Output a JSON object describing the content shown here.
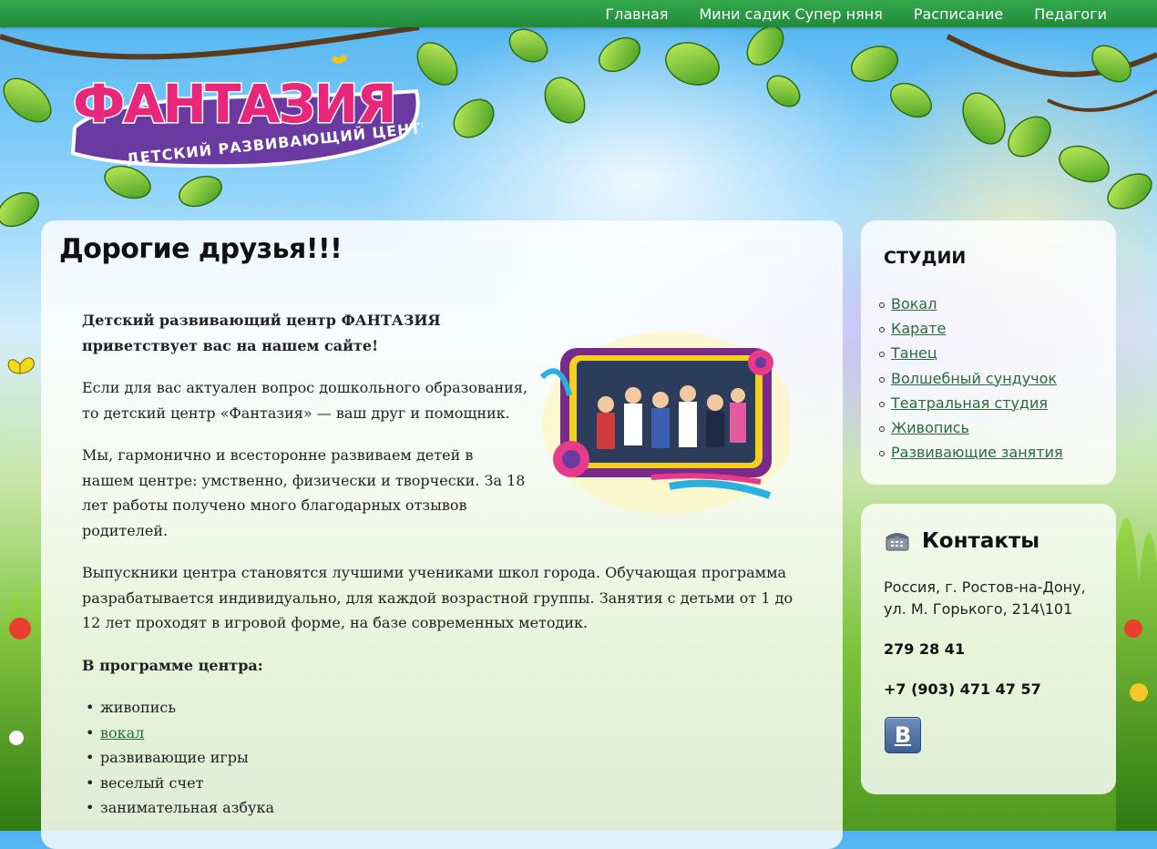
{
  "nav": {
    "items": [
      {
        "label": "Главная"
      },
      {
        "label": "Мини садик Супер няня"
      },
      {
        "label": "Расписание"
      },
      {
        "label": "Педагоги"
      }
    ]
  },
  "logo": {
    "title": "ФАНТАЗИЯ",
    "subtitle": "ДЕТСКИЙ РАЗВИВАЮЩИЙ ЦЕНТР"
  },
  "main": {
    "heading": "Дорогие друзья!!!",
    "lead": "Детский развивающий центр ФАНТАЗИЯ приветствует вас на нашем сайте!",
    "p1": "Если для вас актуален вопрос дошкольного образования, то детский центр «Фантазия» — ваш друг и помощник.",
    "p2": "Мы, гармонично и всесторонне развиваем детей в нашем центре: умственно, физически и творчески. За 18 лет работы получено много благодарных отзывов родителей.",
    "p3": "Выпускники центра становятся лучшими учениками школ города. Обучающая программа разрабатывается индивидуально, для каждой возрастной группы. Занятия с детьми от 1 до 12 лет проходят в игровой форме, на базе современных методик.",
    "program_title": "В программе центра:",
    "program": [
      {
        "label": "живопись",
        "link": false
      },
      {
        "label": "вокал",
        "link": true
      },
      {
        "label": "развивающие игры",
        "link": false
      },
      {
        "label": "веселый счет",
        "link": false
      },
      {
        "label": "занимательная азбука",
        "link": false
      }
    ]
  },
  "studios": {
    "title": "СТУДИИ",
    "items": [
      {
        "label": "Вокал"
      },
      {
        "label": "Карате"
      },
      {
        "label": "Танец"
      },
      {
        "label": "Волшебный сундучок"
      },
      {
        "label": "Театральная студия"
      },
      {
        "label": "Живопись"
      },
      {
        "label": "Развивающие занятия"
      }
    ]
  },
  "contacts": {
    "title": "Контакты",
    "address_line1": "Россия, г. Ростов-на-Дону,",
    "address_line2": "ул. М. Горького, 214\\101",
    "phone1": "279 28 41",
    "phone2": "+7 (903) 471 47 57",
    "vk_letter": "В"
  },
  "colors": {
    "nav_green": "#2a9a45",
    "link": "#2a6a40",
    "logo_purple": "#6a3aa0"
  },
  "icons": {
    "phone": "telephone-icon",
    "social": "vk-icon"
  }
}
